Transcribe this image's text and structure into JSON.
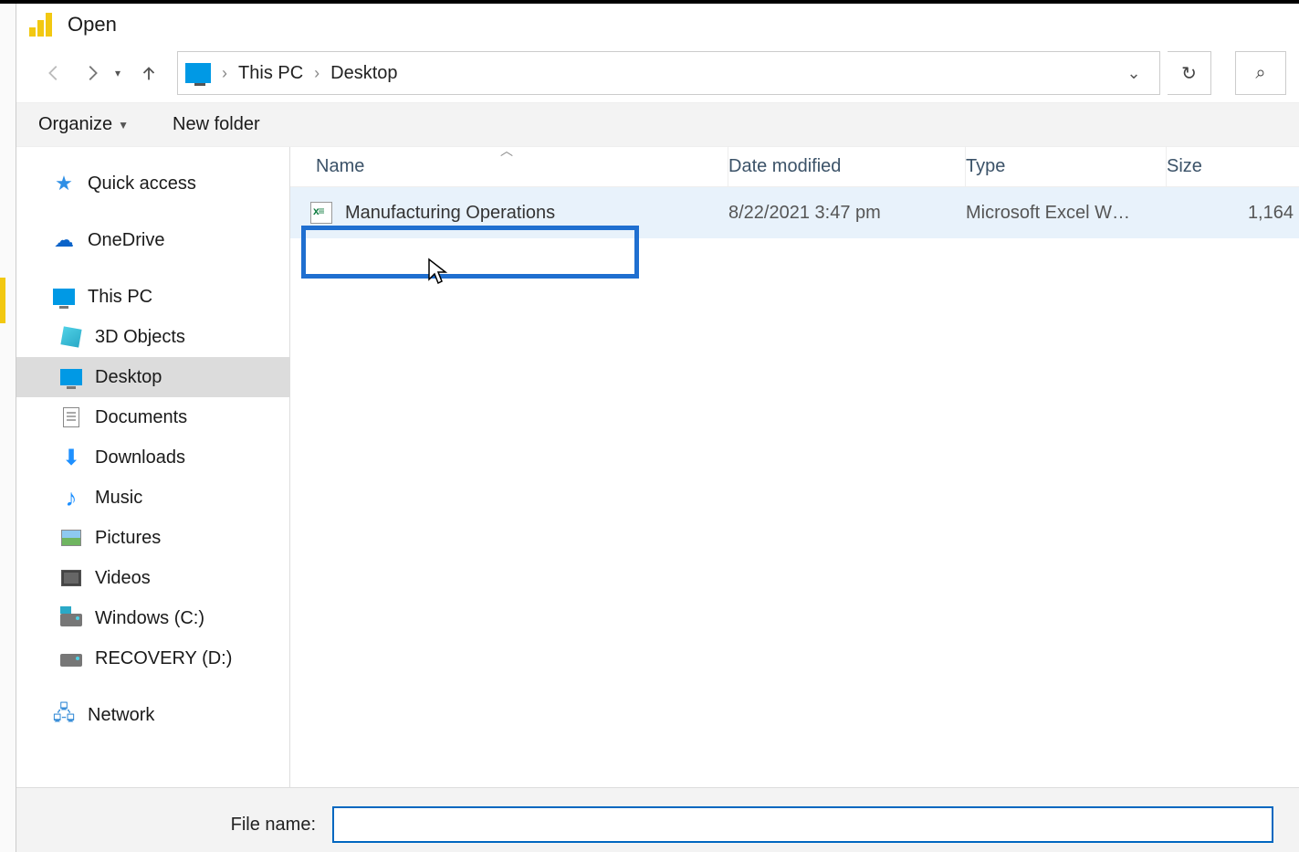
{
  "title": "Open",
  "breadcrumb": {
    "root": "This PC",
    "leaf": "Desktop"
  },
  "toolbar": {
    "organize": "Organize",
    "newfolder": "New folder"
  },
  "sidebar": {
    "quick": "Quick access",
    "onedrive": "OneDrive",
    "thispc": "This PC",
    "objects3d": "3D Objects",
    "desktop": "Desktop",
    "documents": "Documents",
    "downloads": "Downloads",
    "music": "Music",
    "pictures": "Pictures",
    "videos": "Videos",
    "drive_c": "Windows (C:)",
    "drive_d": "RECOVERY (D:)",
    "network": "Network"
  },
  "columns": {
    "name": "Name",
    "date": "Date modified",
    "type": "Type",
    "size": "Size"
  },
  "files": [
    {
      "name": "Manufacturing Operations",
      "date": "8/22/2021 3:47 pm",
      "type": "Microsoft Excel W…",
      "size": "1,164"
    }
  ],
  "footer": {
    "filename_label": "File name:",
    "filename_value": ""
  }
}
